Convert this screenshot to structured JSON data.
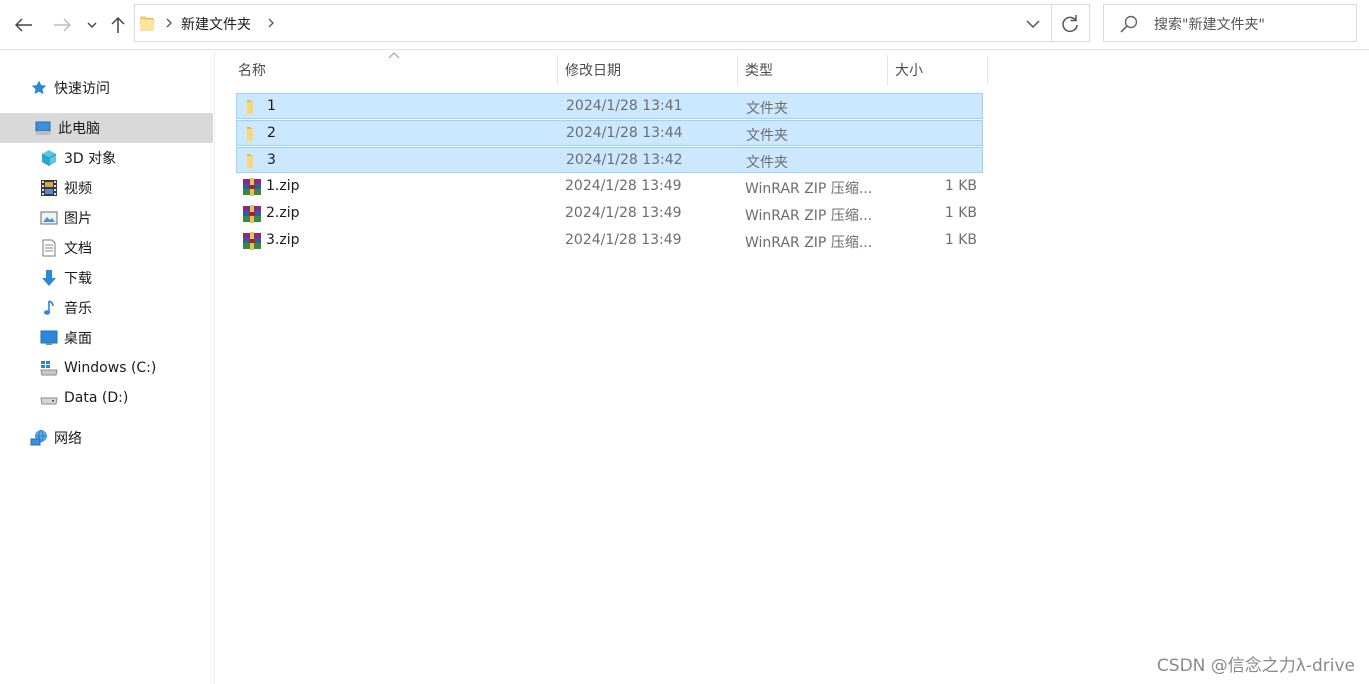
{
  "toolbar": {
    "back_icon": "arrow-left-icon",
    "forward_icon": "arrow-right-icon",
    "recent_icon": "chevron-down-icon",
    "up_icon": "arrow-up-icon"
  },
  "address": {
    "crumb": "新建文件夹",
    "refresh_icon": "refresh-icon"
  },
  "search": {
    "placeholder": "搜索\"新建文件夹\""
  },
  "sidebar": {
    "items": [
      {
        "label": "快速访问",
        "icon": "star-icon"
      },
      {
        "label": "此电脑",
        "icon": "computer-icon",
        "selected": true
      },
      {
        "label": "3D 对象",
        "icon": "cube-3d-icon"
      },
      {
        "label": "视频",
        "icon": "film-icon"
      },
      {
        "label": "图片",
        "icon": "picture-icon"
      },
      {
        "label": "文档",
        "icon": "document-icon"
      },
      {
        "label": "下载",
        "icon": "download-arrow-icon"
      },
      {
        "label": "音乐",
        "icon": "music-note-icon"
      },
      {
        "label": "桌面",
        "icon": "desktop-icon"
      },
      {
        "label": "Windows (C:)",
        "icon": "windows-drive-icon"
      },
      {
        "label": "Data (D:)",
        "icon": "drive-icon"
      },
      {
        "label": "网络",
        "icon": "network-icon"
      }
    ]
  },
  "columns": {
    "name": "名称",
    "date": "修改日期",
    "type": "类型",
    "size": "大小"
  },
  "files": [
    {
      "name": "1",
      "date": "2024/1/28 13:41",
      "type": "文件夹",
      "size": "",
      "icon": "folder-icon",
      "selected": true
    },
    {
      "name": "2",
      "date": "2024/1/28 13:44",
      "type": "文件夹",
      "size": "",
      "icon": "folder-icon",
      "selected": true
    },
    {
      "name": "3",
      "date": "2024/1/28 13:42",
      "type": "文件夹",
      "size": "",
      "icon": "folder-icon",
      "selected": true
    },
    {
      "name": "1.zip",
      "date": "2024/1/28 13:49",
      "type": "WinRAR ZIP 压缩...",
      "size": "1 KB",
      "icon": "winrar-archive-icon",
      "selected": false
    },
    {
      "name": "2.zip",
      "date": "2024/1/28 13:49",
      "type": "WinRAR ZIP 压缩...",
      "size": "1 KB",
      "icon": "winrar-archive-icon",
      "selected": false
    },
    {
      "name": "3.zip",
      "date": "2024/1/28 13:49",
      "type": "WinRAR ZIP 压缩...",
      "size": "1 KB",
      "icon": "winrar-archive-icon",
      "selected": false
    }
  ],
  "watermark": "CSDN @信念之力λ-drive",
  "colors": {
    "selection_bg": "#cce8ff",
    "selection_border": "#99d1ff",
    "sidebar_selected": "#d9d9d9",
    "folder_yellow": "#f8d775"
  }
}
